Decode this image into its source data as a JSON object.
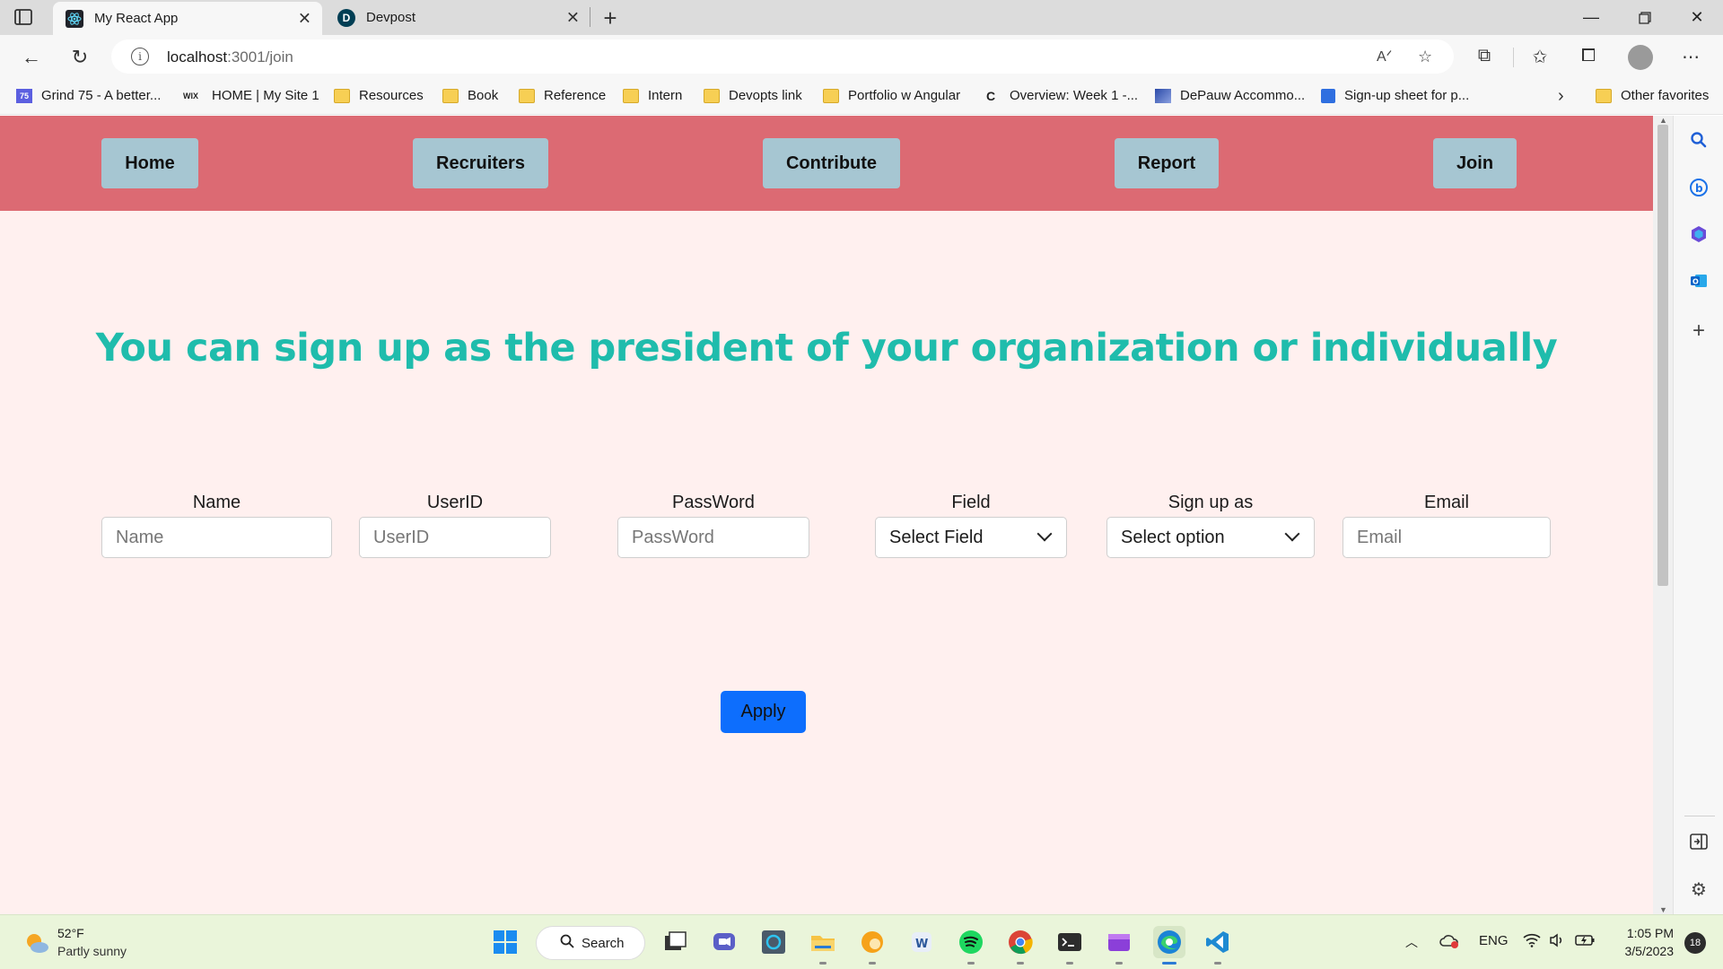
{
  "browser": {
    "tabs": [
      {
        "title": "My React App",
        "active": true,
        "favicon": "react-icon"
      },
      {
        "title": "Devpost",
        "active": false,
        "favicon": "devpost-icon",
        "favicon_text": "D"
      }
    ],
    "address": {
      "host": "localhost",
      "path": ":3001/join"
    },
    "favorites": [
      {
        "label": "Grind 75 - A better...",
        "icon": "grind75-icon",
        "icon_text": "75"
      },
      {
        "label": "HOME | My Site 1",
        "icon": "wix-icon",
        "icon_text": "WIX"
      },
      {
        "label": "Resources",
        "icon": "folder-icon"
      },
      {
        "label": "Book",
        "icon": "folder-icon"
      },
      {
        "label": "Reference",
        "icon": "folder-icon"
      },
      {
        "label": "Intern",
        "icon": "folder-icon"
      },
      {
        "label": "Devopts link",
        "icon": "folder-icon"
      },
      {
        "label": "Portfolio w Angular",
        "icon": "folder-icon"
      },
      {
        "label": "Overview: Week 1 -...",
        "icon": "coursera-icon",
        "icon_text": "C"
      },
      {
        "label": "DePauw Accommo...",
        "icon": "depauw-icon"
      },
      {
        "label": "Sign-up sheet for p...",
        "icon": "docs-icon"
      }
    ],
    "other_favorites": "Other favorites"
  },
  "app": {
    "nav": [
      "Home",
      "Recruiters",
      "Contribute",
      "Report",
      "Join"
    ],
    "headline": "You can sign up as the president of your organization or individually",
    "form": {
      "name": {
        "label": "Name",
        "placeholder": "Name"
      },
      "userid": {
        "label": "UserID",
        "placeholder": "UserID"
      },
      "password": {
        "label": "PassWord",
        "placeholder": "PassWord"
      },
      "field": {
        "label": "Field",
        "selected": "Select Field"
      },
      "signup_as": {
        "label": "Sign up as",
        "selected": "Select option"
      },
      "email": {
        "label": "Email",
        "placeholder": "Email"
      }
    },
    "apply_label": "Apply",
    "colors": {
      "navbar": "#dc6a73",
      "nav_button": "#a6c6d2",
      "headline": "#1fbcac",
      "background": "#fff0ef",
      "apply": "#0d6efd"
    }
  },
  "taskbar": {
    "weather": {
      "temp": "52°F",
      "desc": "Partly sunny"
    },
    "search_label": "Search",
    "language": "ENG",
    "time": "1:05 PM",
    "date": "3/5/2023",
    "notifications": "18"
  }
}
